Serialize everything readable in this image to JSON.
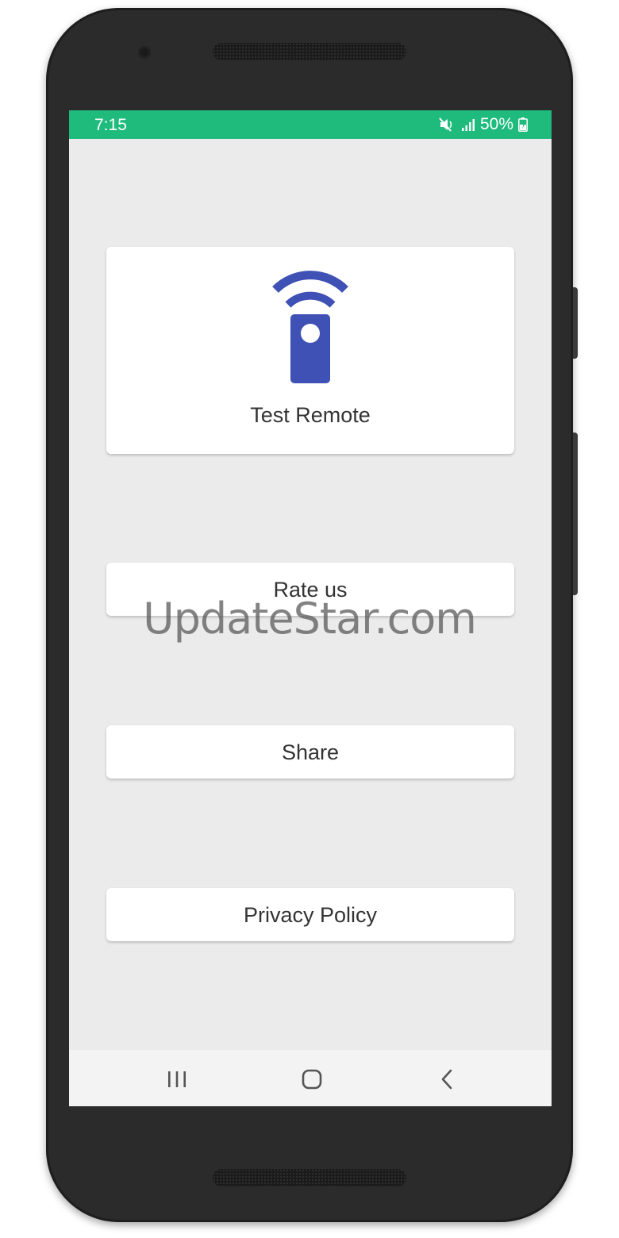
{
  "status_bar": {
    "time": "7:15",
    "battery": "50%",
    "background_color": "#1fbb7d"
  },
  "main": {
    "remote_card": {
      "label": "Test Remote",
      "icon": "remote-control-icon",
      "icon_color": "#3f51b5"
    },
    "buttons": [
      {
        "label": "Rate us"
      },
      {
        "label": "Share"
      },
      {
        "label": "Privacy Policy"
      }
    ]
  },
  "watermark": "UpdateStar.com",
  "nav_bar": {
    "icons": [
      "recents-icon",
      "home-icon",
      "back-icon"
    ]
  }
}
